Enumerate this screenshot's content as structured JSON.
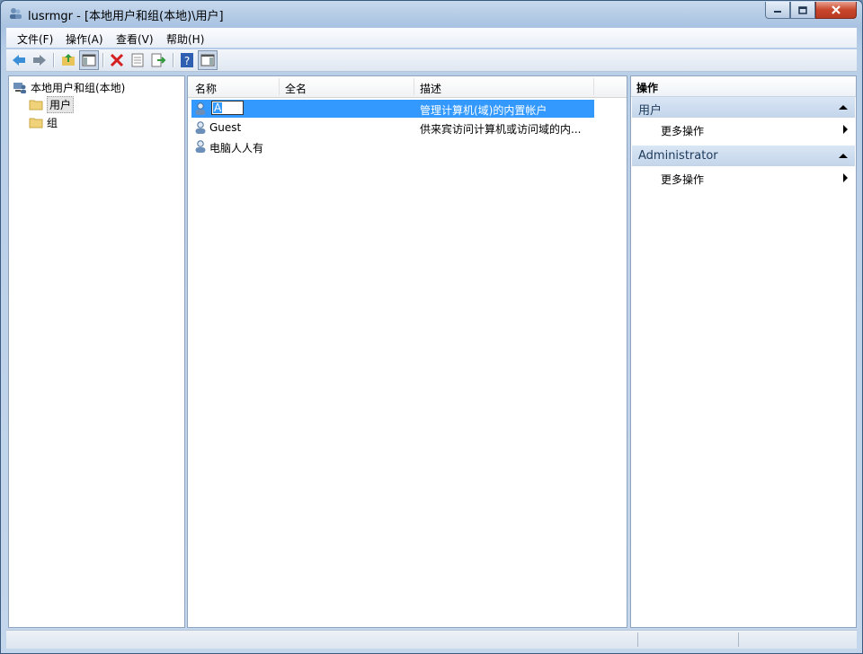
{
  "window": {
    "title": "lusrmgr - [本地用户和组(本地)\\用户]",
    "icons": [
      "users-app-icon",
      "minimize-icon",
      "restore-icon",
      "close-icon"
    ]
  },
  "menu": [
    {
      "label": "文件(F)"
    },
    {
      "label": "操作(A)"
    },
    {
      "label": "查看(V)"
    },
    {
      "label": "帮助(H)"
    }
  ],
  "toolbar": {
    "icons": [
      "back-arrow-icon",
      "forward-arrow-icon",
      "up-folder-icon",
      "show-hide-tree-icon",
      "delete-icon",
      "properties-icon",
      "export-list-icon",
      "help-icon",
      "show-hide-action-pane-icon"
    ]
  },
  "tree": {
    "root": "本地用户和组(本地)",
    "items": [
      {
        "label": "用户",
        "selected": true
      },
      {
        "label": "组",
        "selected": false
      }
    ]
  },
  "list": {
    "columns": [
      "名称",
      "全名",
      "描述"
    ],
    "rows": [
      {
        "name": "A",
        "fullname": "",
        "description": "管理计算机(域)的内置帐户",
        "selected": true,
        "editing": true
      },
      {
        "name": "Guest",
        "fullname": "",
        "description": "供来宾访问计算机或访问域的内...",
        "selected": false
      },
      {
        "name": "电脑人人有",
        "fullname": "",
        "description": "",
        "selected": false
      }
    ]
  },
  "actions": {
    "title": "操作",
    "sections": [
      {
        "label": "用户",
        "item": "更多操作"
      },
      {
        "label": "Administrator",
        "item": "更多操作"
      }
    ]
  },
  "colors": {
    "selection": "#3399ff",
    "section_header": "#c4d5ea",
    "delete_red": "#d42020"
  }
}
